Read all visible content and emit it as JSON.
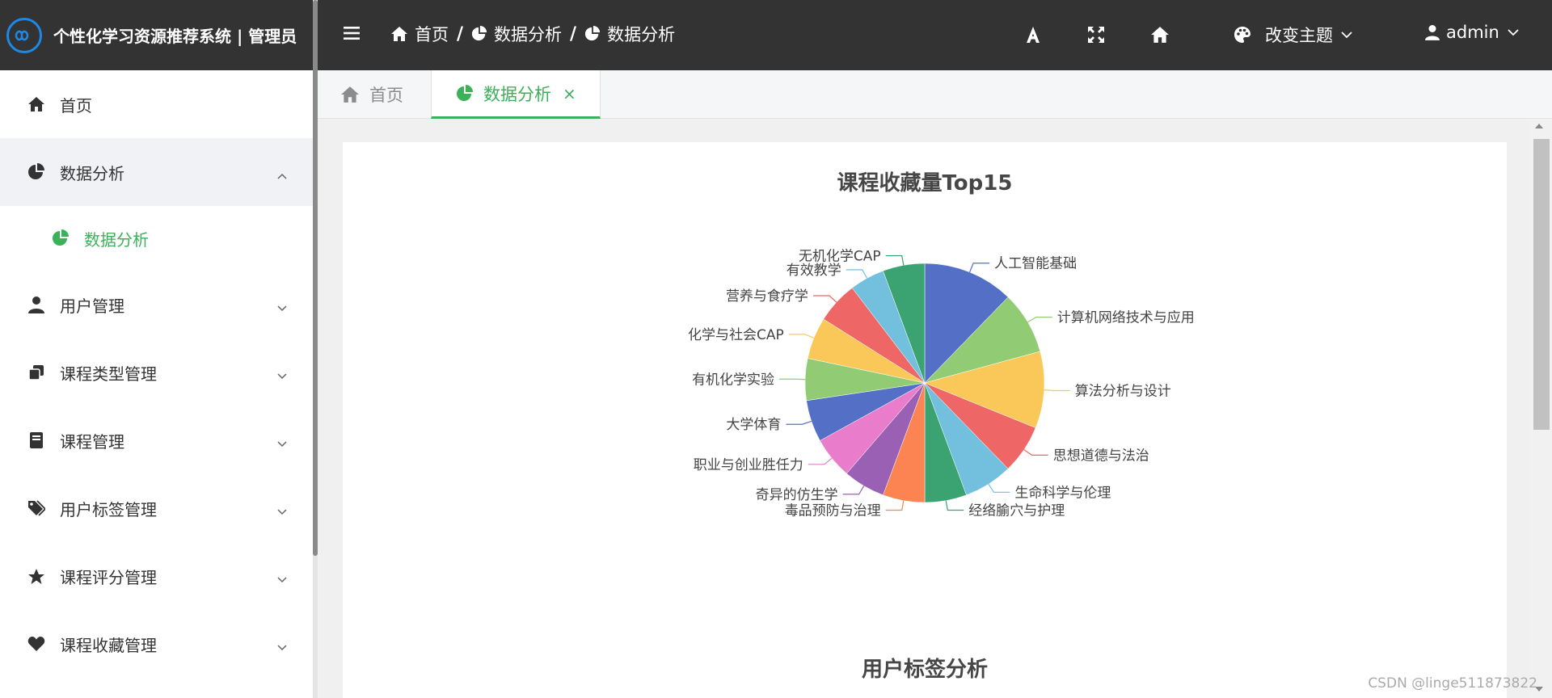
{
  "app": {
    "title": "个性化学习资源推荐系统 | 管理员"
  },
  "sidebar": {
    "items": [
      {
        "label": "首页",
        "icon": "home-icon"
      },
      {
        "label": "数据分析",
        "icon": "pie-chart-icon",
        "expanded": true
      },
      {
        "label": "数据分析",
        "icon": "pie-chart-icon",
        "sub": true,
        "active": true
      },
      {
        "label": "用户管理",
        "icon": "user-icon"
      },
      {
        "label": "课程类型管理",
        "icon": "copy-icon"
      },
      {
        "label": "课程管理",
        "icon": "book-icon"
      },
      {
        "label": "用户标签管理",
        "icon": "tags-icon"
      },
      {
        "label": "课程评分管理",
        "icon": "star-icon"
      },
      {
        "label": "课程收藏管理",
        "icon": "heart-icon"
      }
    ]
  },
  "header": {
    "breadcrumbs": [
      "首页",
      "数据分析",
      "数据分析"
    ],
    "theme_label": "改变主题",
    "username": "admin"
  },
  "tabs": {
    "home_label": "首页",
    "active_label": "数据分析",
    "close_symbol": "×"
  },
  "colors": {
    "accent": "#3bb15a",
    "header_bg": "#333333"
  },
  "chart_data": [
    {
      "type": "pie",
      "title": "课程收藏量Top15",
      "slices": [
        {
          "name": "人工智能基础",
          "value": 13,
          "color": "#5470c6"
        },
        {
          "name": "计算机网络技术与应用",
          "value": 9,
          "color": "#91cc75"
        },
        {
          "name": "算法分析与设计",
          "value": 11,
          "color": "#fac858"
        },
        {
          "name": "思想道德与法治",
          "value": 7,
          "color": "#ee6666"
        },
        {
          "name": "生命科学与伦理",
          "value": 7,
          "color": "#73c0de"
        },
        {
          "name": "经络腧穴与护理",
          "value": 6,
          "color": "#3ba272"
        },
        {
          "name": "毒品预防与治理",
          "value": 6,
          "color": "#fc8452"
        },
        {
          "name": "奇异的仿生学",
          "value": 6,
          "color": "#9a60b4"
        },
        {
          "name": "职业与创业胜任力",
          "value": 6,
          "color": "#ea7ccc"
        },
        {
          "name": "大学体育",
          "value": 6,
          "color": "#5470c6"
        },
        {
          "name": "有机化学实验",
          "value": 6,
          "color": "#91cc75"
        },
        {
          "name": "化学与社会CAP",
          "value": 6,
          "color": "#fac858"
        },
        {
          "name": "营养与食疗学",
          "value": 6,
          "color": "#ee6666"
        },
        {
          "name": "有效教学",
          "value": 5,
          "color": "#73c0de"
        },
        {
          "name": "无机化学CAP",
          "value": 6,
          "color": "#3ba272"
        }
      ]
    },
    {
      "type": "pie",
      "title": "用户标签分析"
    }
  ],
  "watermark": "CSDN @linge511873822"
}
